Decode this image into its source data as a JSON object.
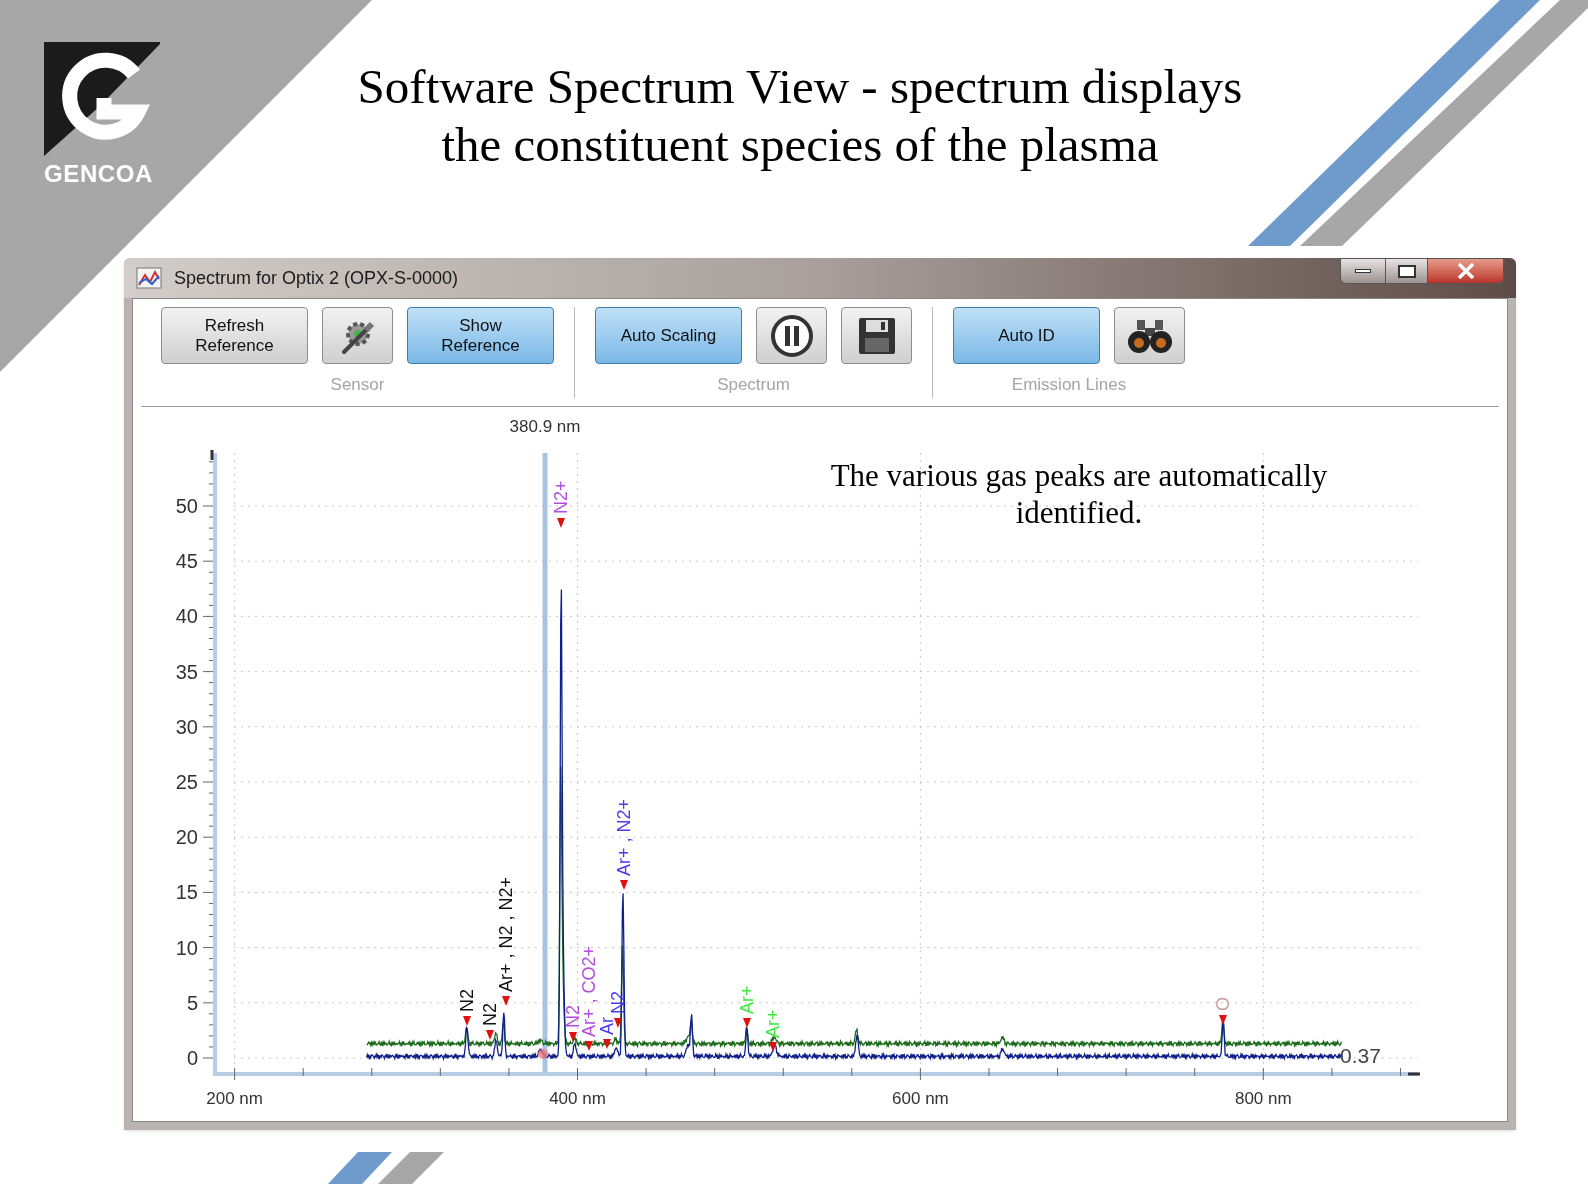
{
  "slide": {
    "logo_text": "GENCOA",
    "title_lines": [
      "Software Spectrum View - spectrum displays",
      "the constituent species of the plasma"
    ]
  },
  "window": {
    "title": "Spectrum for Optix 2 (OPX-S-0000)"
  },
  "toolbar": {
    "groups": [
      {
        "label": "Sensor",
        "buttons": [
          {
            "kind": "text",
            "label": "Refresh Reference",
            "on": false
          },
          {
            "kind": "settings",
            "on": false
          },
          {
            "kind": "text",
            "label": "Show Reference",
            "on": true
          }
        ]
      },
      {
        "label": "Spectrum",
        "buttons": [
          {
            "kind": "text",
            "label": "Auto Scaling",
            "on": true
          },
          {
            "kind": "pause",
            "on": false
          },
          {
            "kind": "save",
            "on": false
          }
        ]
      },
      {
        "label": "Emission Lines",
        "buttons": [
          {
            "kind": "text",
            "label": "Auto ID",
            "on": true
          },
          {
            "kind": "binoculars",
            "on": false
          }
        ]
      }
    ]
  },
  "chart": {
    "cursor_label": "380.9 nm",
    "yticks": [
      "50",
      "45",
      "40",
      "35",
      "30",
      "25",
      "20",
      "15",
      "10",
      "5",
      "0"
    ],
    "xticks": [
      "200 nm",
      "400 nm",
      "600 nm",
      "800 nm"
    ],
    "end_value": "0.37",
    "peak_labels": [
      {
        "text": "N2",
        "color": "#111111"
      },
      {
        "text": "N2",
        "color": "#111111"
      },
      {
        "text": "Ar+ , N2 , N2+",
        "color": "#111111"
      },
      {
        "text": "N2+",
        "color": "#b24ee0"
      },
      {
        "text": "N2",
        "color": "#b24ee0"
      },
      {
        "text": "Ar+ , CO2+",
        "color": "#b24ee0"
      },
      {
        "text": "Ar",
        "color": "#4a3cf0"
      },
      {
        "text": "N2",
        "color": "#4a3cf0"
      },
      {
        "text": "Ar+ , N2+",
        "color": "#4a3cf0"
      },
      {
        "text": "Ar+",
        "color": "#3ee83e"
      },
      {
        "text": "Ar+",
        "color": "#3ee83e"
      },
      {
        "text": "O",
        "color": "#c8a0a0"
      }
    ]
  },
  "note": "The various gas peaks are automatically identified."
}
